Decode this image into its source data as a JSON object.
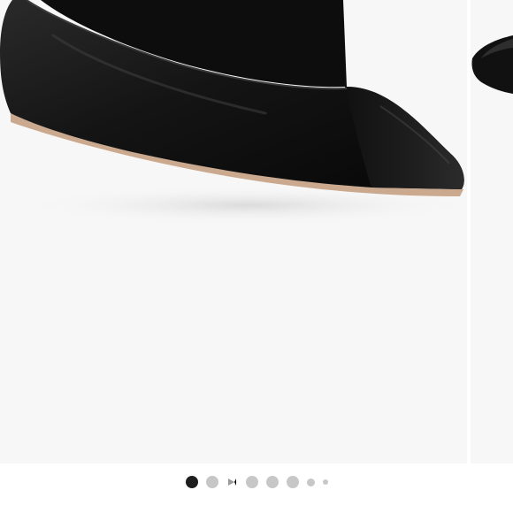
{
  "gallery": {
    "image_subject": "black-leather-square-toe-ballet-flat",
    "slide_count": 8,
    "active_slide": 1,
    "video_slide_index": 2,
    "colors": {
      "slide_bg": "#f7f7f7",
      "dot_active": "#1e1e1e",
      "dot_inactive": "#c7c7c7",
      "play_icon": "#9a9a9a"
    }
  }
}
